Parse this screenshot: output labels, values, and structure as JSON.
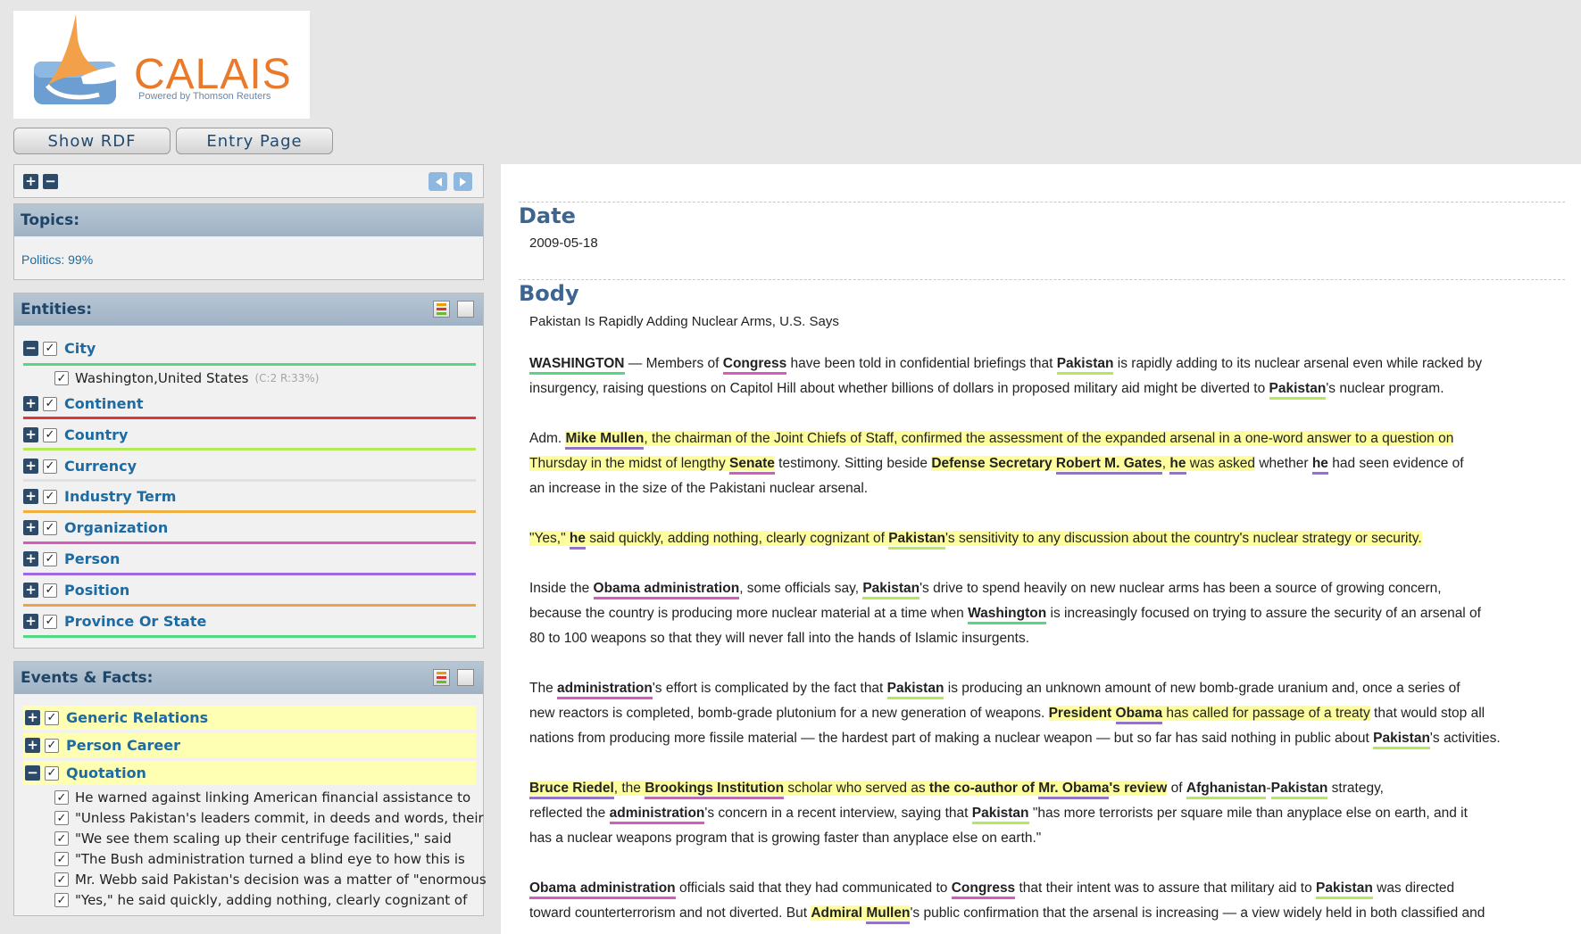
{
  "logo": {
    "text": "CALAIS",
    "tagline": "Powered by Thomson Reuters"
  },
  "buttons": {
    "show_rdf": "Show RDF",
    "entry_page": "Entry Page"
  },
  "toolbar": {
    "expand": "+",
    "collapse": "−"
  },
  "topics": {
    "title": "Topics:",
    "value": "Politics: 99%"
  },
  "entities": {
    "title": "Entities:",
    "items": [
      {
        "label": "City",
        "expanded": true,
        "line_color": "#55d884",
        "children": [
          {
            "label": "Washington,United States",
            "meta": "(C:2 R:33%)"
          }
        ]
      },
      {
        "label": "Continent",
        "line_color": "#d53c3c"
      },
      {
        "label": "Country",
        "line_color": "#b4ea5a"
      },
      {
        "label": "Currency",
        "line_color": "#cccccc"
      },
      {
        "label": "Industry Term",
        "line_color": "#f0b040"
      },
      {
        "label": "Organization",
        "line_color": "#d75bbd"
      },
      {
        "label": "Person",
        "line_color": "#9d68e0"
      },
      {
        "label": "Position",
        "line_color": "#f2a04a"
      },
      {
        "label": "Province Or State",
        "line_color": "#55d884"
      }
    ]
  },
  "events": {
    "title": "Events & Facts:",
    "items": [
      {
        "label": "Generic Relations"
      },
      {
        "label": "Person Career"
      },
      {
        "label": "Quotation",
        "expanded": true
      }
    ],
    "quotations": [
      "He warned against linking American financial assistance to",
      "\"Unless Pakistan's leaders commit, in deeds and words, their",
      "\"We see them scaling up their centrifuge facilities,\" said",
      "\"The Bush administration turned a blind eye to how this is",
      "Mr. Webb said Pakistan's decision was a matter of \"enormous",
      "\"Yes,\" he said quickly, adding nothing, clearly cognizant of"
    ]
  },
  "doc": {
    "date_heading": "Date",
    "date_value": "2009-05-18",
    "body_heading": "Body",
    "headline": "Pakistan Is Rapidly Adding Nuclear Arms, U.S. Says"
  }
}
